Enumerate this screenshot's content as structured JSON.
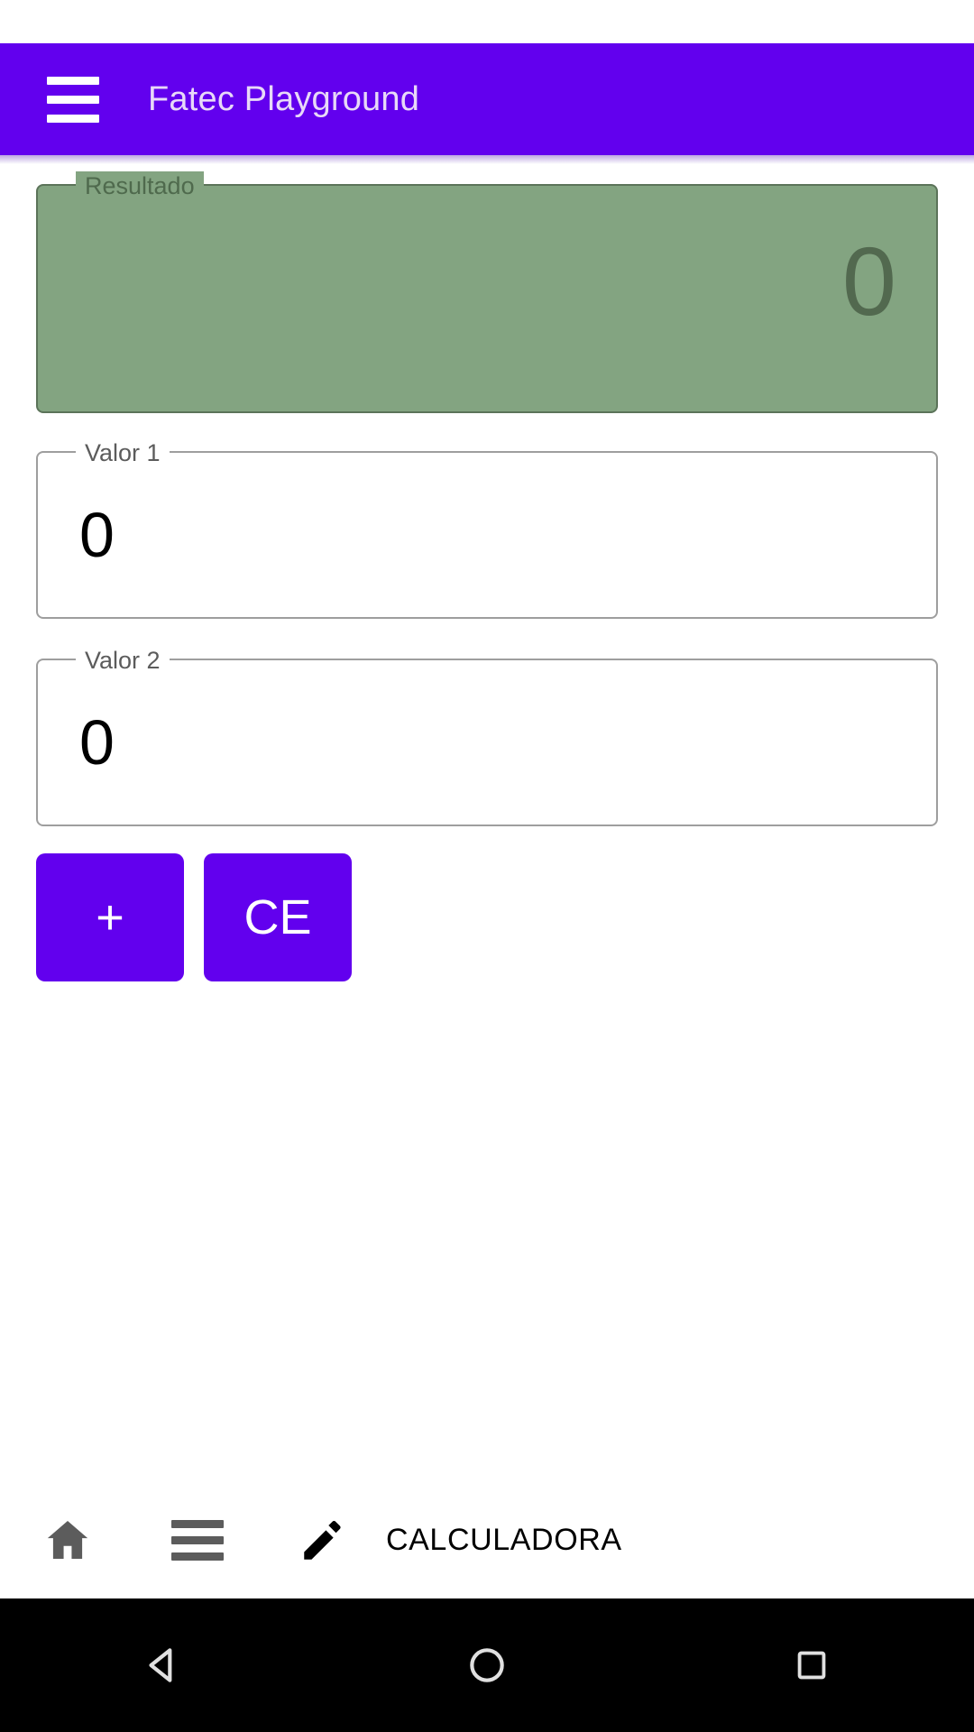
{
  "app": {
    "title": "Fatec Playground",
    "accent_color": "#6200EE",
    "result_fill_color": "#83A481",
    "menu_icon": "hamburger-menu-icon"
  },
  "result": {
    "label": "Resultado",
    "value": "0"
  },
  "inputs": [
    {
      "label": "Valor 1",
      "value": "0"
    },
    {
      "label": "Valor 2",
      "value": "0"
    }
  ],
  "buttons": [
    {
      "label": "+",
      "name": "add-button"
    },
    {
      "label": "CE",
      "name": "clear-entry-button"
    }
  ],
  "bottom_toolbar": {
    "home_icon": "home-icon",
    "list_icon": "list-icon",
    "edit_icon": "pencil-edit-icon",
    "label": "CALCULADORA"
  },
  "system_nav": {
    "back_icon": "back-triangle-icon",
    "home_icon": "home-circle-icon",
    "recents_icon": "recents-square-icon"
  }
}
